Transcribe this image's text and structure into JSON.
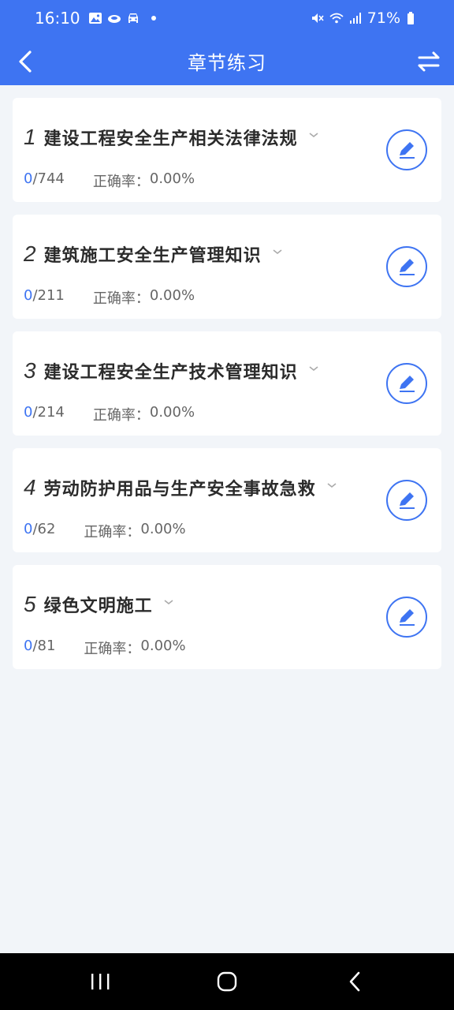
{
  "status": {
    "time": "16:10",
    "battery": "71%",
    "left_icons": [
      "gallery-icon",
      "cloud-icon",
      "car-icon"
    ],
    "right_icons": [
      "mute-icon",
      "wifi-icon",
      "signal-icon",
      "battery-icon"
    ]
  },
  "header": {
    "title": "章节练习",
    "back_icon": "chevron-left-icon",
    "switch_icon": "switch-arrows-icon",
    "color": "#3e74f2"
  },
  "chapters": [
    {
      "index": "1",
      "name": "建设工程安全生产相关法律法规",
      "done": "0",
      "total": "/744",
      "rate_label": "正确率：",
      "rate": "0.00%"
    },
    {
      "index": "2",
      "name": "建筑施工安全生产管理知识",
      "done": "0",
      "total": "/211",
      "rate_label": "正确率：",
      "rate": "0.00%"
    },
    {
      "index": "3",
      "name": "建设工程安全生产技术管理知识",
      "done": "0",
      "total": "/214",
      "rate_label": "正确率：",
      "rate": "0.00%"
    },
    {
      "index": "4",
      "name": "劳动防护用品与生产安全事故急救",
      "done": "0",
      "total": "/62",
      "rate_label": "正确率：",
      "rate": "0.00%"
    },
    {
      "index": "5",
      "name": "绿色文明施工",
      "done": "0",
      "total": "/81",
      "rate_label": "正确率：",
      "rate": "0.00%"
    }
  ],
  "system_nav": [
    "recent-apps-icon",
    "home-icon",
    "back-icon"
  ]
}
